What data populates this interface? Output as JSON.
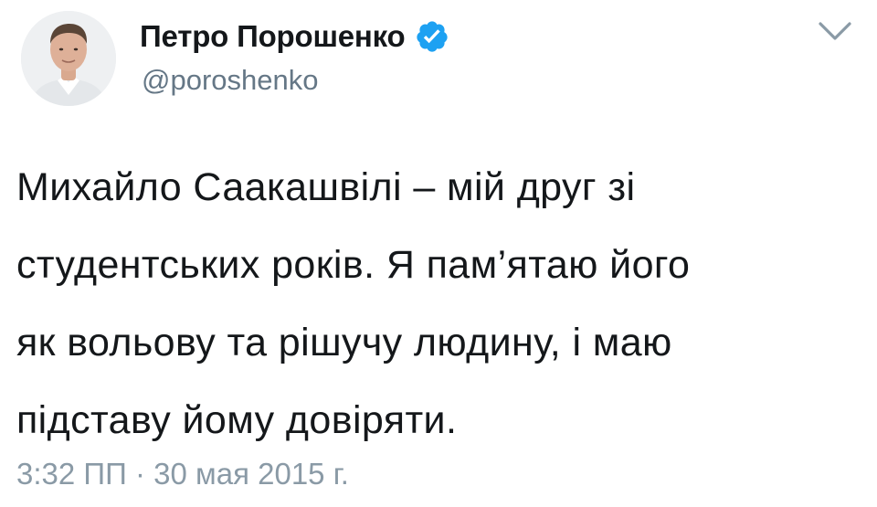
{
  "tweet": {
    "author": {
      "display_name": "Петро Порошенко",
      "handle": "@poroshenko",
      "verified": true,
      "avatar_icon": "user-photo-avatar"
    },
    "text_lines": [
      "Михайло Саакашвілі – мій друг зі",
      "студентських років. Я пам’ятаю його",
      "як вольову та рішучу людину, і маю",
      "підставу йому довіряти."
    ],
    "timestamp": "3:32 ПП · 30 мая 2015 г.",
    "menu_icon": "chevron-down-icon"
  },
  "colors": {
    "text": "#14171a",
    "secondary": "#657786",
    "timestamp": "#8a9aa6",
    "verified_badge": "#1da1f2",
    "background": "#ffffff"
  }
}
